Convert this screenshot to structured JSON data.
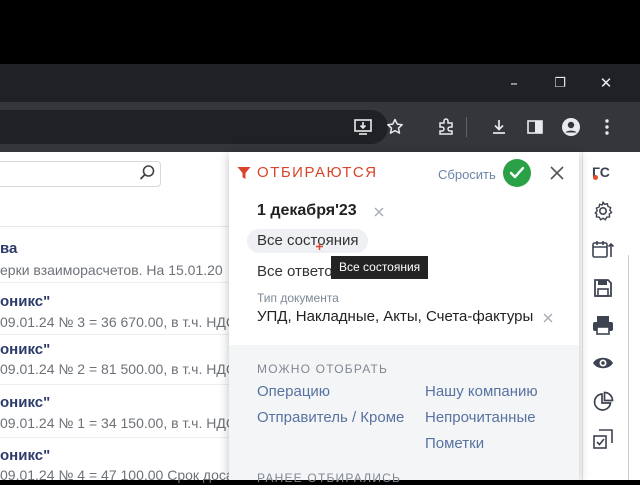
{
  "browser": {
    "window_controls": {
      "minimize": "–",
      "maximize": "❐",
      "close": "✕"
    }
  },
  "page": {
    "search": {
      "placeholder": "",
      "value": ""
    },
    "items": [
      {
        "title": "ва",
        "subtitle": "ерки взаиморасчетов. На 15.01.20"
      },
      {
        "title": "оникс\"",
        "subtitle": "09.01.24 № 3 = 36 670.00, в т.ч. НДС"
      },
      {
        "title": "оникс\"",
        "subtitle": "09.01.24 № 2 = 81 500.00, в т.ч. НДС"
      },
      {
        "title": "оникс\"",
        "subtitle": "09.01.24 № 1 = 34 150.00, в т.ч. НДС"
      },
      {
        "title": "оникс\"",
        "subtitle": "09.01.24 № 4 = 47 100.00 Срок доса"
      }
    ]
  },
  "rail": {
    "gs_label": "ГС"
  },
  "filter_panel": {
    "title": "ОТБИРАЮТСЯ",
    "reset_label": "Сбросить",
    "date": "1 декабря'23",
    "states_chip": "Все состояния",
    "answers": "Все ответо",
    "tooltip": "Все состояния",
    "doc_type_label": "Тип документа",
    "doc_type_value": "УПД, Накладные, Акты, Счета-фактуры",
    "can_select_title": "МОЖНО ОТОБРАТЬ",
    "options_left": [
      "Операцию",
      "Отправитель / Кроме"
    ],
    "options_right": [
      "Нашу компанию",
      "Непрочитанные",
      "Пометки"
    ],
    "previous_title": "РАНЕЕ ОТБИРАЛИСЬ"
  },
  "colors": {
    "accent": "#d9452a",
    "ok": "#2aa147",
    "link": "#5873a0",
    "chrome": "#35363a"
  }
}
